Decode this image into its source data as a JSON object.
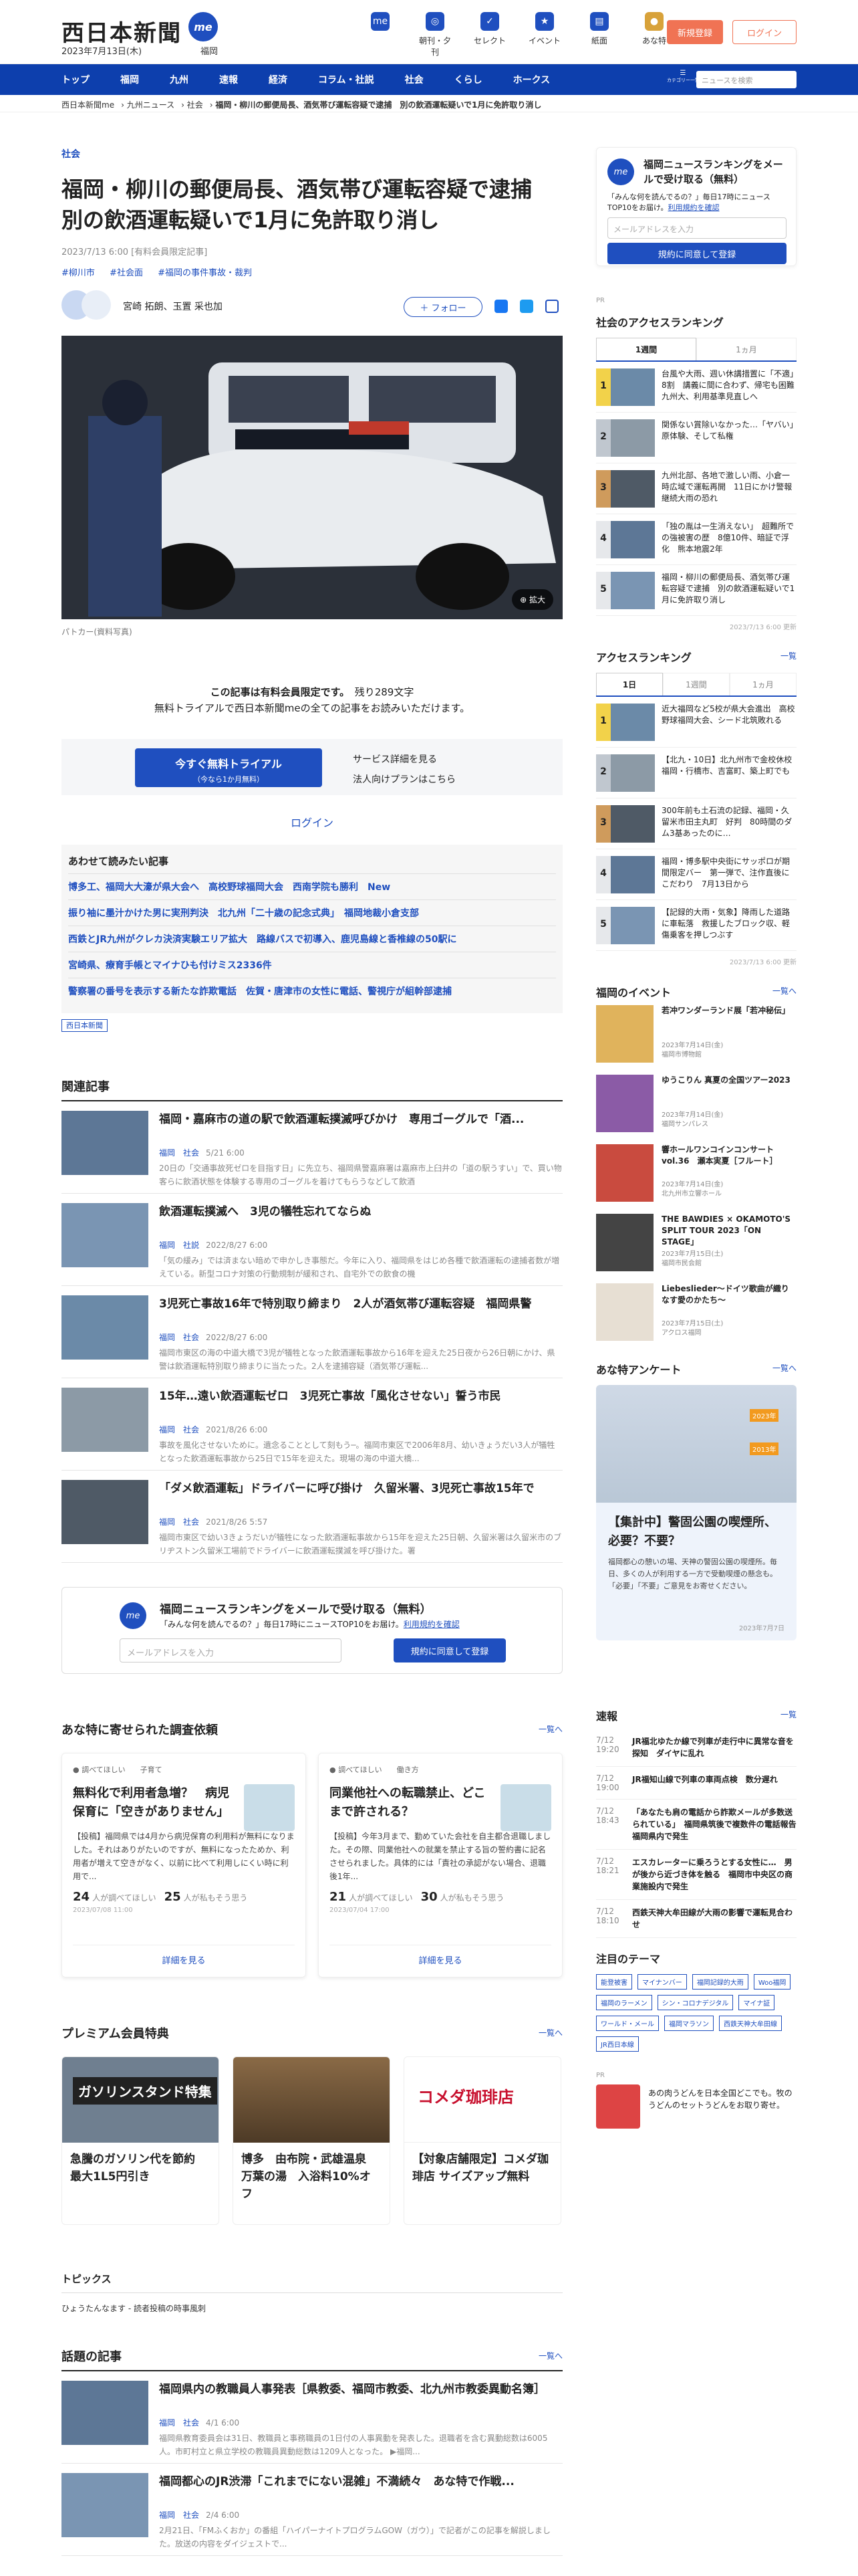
{
  "header": {
    "logo": "西日本新聞",
    "date": "2023年7月13日(木)",
    "me": "me",
    "region": "福岡",
    "icons": [
      "朝刊・夕刊",
      "セレクト",
      "イベント",
      "紙面",
      "あな特"
    ],
    "first_icon": "me",
    "register": "新規登録",
    "login": "ログイン"
  },
  "nav": {
    "items": [
      "トップ",
      "福岡",
      "九州",
      "速報",
      "経済",
      "コラム・社説",
      "社会",
      "くらし",
      "ホークス"
    ],
    "menu": "カテゴリー一覧",
    "search_placeholder": "ニュースを検索"
  },
  "breadcrumb": [
    "西日本新聞me",
    "九州ニュース",
    "社会",
    "福岡・柳川の郵便局長、酒気帯び運転容疑で逮捕　別の飲酒運転疑いで1月に免許取り消し"
  ],
  "article": {
    "category": "社会",
    "title": "福岡・柳川の郵便局長、酒気帯び運転容疑で逮捕　別の飲酒運転疑いで1月に免許取り消し",
    "meta": "2023/7/13 6:00 [有料会員限定記事]",
    "tags": [
      "#柳川市",
      "#社会面",
      "#福岡の事件事故・裁判"
    ],
    "authors": "宮崎 拓朗、玉置 采也加",
    "follow": "＋ フォロー",
    "zoom": "拡大",
    "caption": "パトカー(資料写真)"
  },
  "paywall": {
    "line1": "この記事は有料会員限定です。",
    "remaining": "残り289文字",
    "line2": "無料トライアルで西日本新聞meの全ての記事をお読みいただけます。",
    "trial": "今すぐ無料トライアル",
    "trial_sub": "（今なら1か月無料）",
    "svc": "サービス詳細を見る",
    "corp": "法人向けプランはこちら",
    "login": "ログイン"
  },
  "together": {
    "title": "あわせて読みたい記事",
    "items": [
      "博多工、福岡大大濠が県大会へ　高校野球福岡大会　西南学院も勝利　New",
      "振り袖に墨汁かけた男に実刑判決　北九州「二十歳の記念式典」　福岡地裁小倉支部",
      "西鉄とJR九州がクレカ決済実験エリア拡大　路線バスで初導入、鹿児島線と香椎線の50駅に",
      "宮崎県、療育手帳とマイナひも付けミス2336件",
      "警察署の番号を表示する新たな詐欺電話　佐賀・唐津市の女性に電話、警視庁が組幹部逮捕"
    ],
    "tag": "西日本新聞"
  },
  "related": {
    "title": "関連記事",
    "items": [
      {
        "t": "福岡・嘉麻市の道の駅で飲酒運転撲滅呼びかけ　専用ゴーグルで「酒...",
        "c": "福岡",
        "s": "社会",
        "dt": "5/21 6:00",
        "d": "20日の「交通事故死ゼロを目指す日」に先立ち、福岡県警嘉麻署は嘉麻市上臼井の「道の駅うすい」で、買い物客らに飲酒状態を体験する専用のゴーグルを着けてもらうなどして飲酒"
      },
      {
        "t": "飲酒運転撲滅へ　3児の犠牲忘れてならぬ",
        "c": "福岡",
        "s": "社説",
        "dt": "2022/8/27 6:00",
        "d": "「気の緩み」では済まない暗めで申かしき事態だ。今年に入り、福岡県をはじめ各種で飲酒運転の逮捕者数が増えている。新型コロナ対策の行動規制が緩和され、自宅外での飲食の機"
      },
      {
        "t": "3児死亡事故16年で特別取り締まり　2人が酒気帯び運転容疑　福岡県警",
        "c": "福岡",
        "s": "社会",
        "dt": "2022/8/27 6:00",
        "d": "福岡市東区の海の中道大橋で3児が犠牲となった飲酒運転事故から16年を迎えた25日夜から26日朝にかけ、県警は飲酒運転特別取り締まりに当たった。2人を逮捕容疑（酒気帯び運転..."
      },
      {
        "t": "15年…遠い飲酒運転ゼロ　3児死亡事故「風化させない」誓う市民",
        "c": "福岡",
        "s": "社会",
        "dt": "2021/8/26 6:00",
        "d": "事故を風化させないために。遺念ることとして刻もう─。福岡市東区で2006年8月、幼いきょうだい3人が犠牲となった飲酒運転事故から25日で15年を迎えた。現場の海の中道大橋..."
      },
      {
        "t": "「ダメ飲酒運転」ドライバーに呼び掛け　久留米署、3児死亡事故15年で",
        "c": "福岡",
        "s": "社会",
        "dt": "2021/8/26 5:57",
        "d": "福岡市東区で幼い3きょうだいが犠牲になった飲酒運転事故から15年を迎えた25日朝、久留米署は久留米市のブリヂストン久留米工場前でドライバーに飲酒運転撲滅を呼び掛けた。署"
      }
    ]
  },
  "newsletter": {
    "title": "福岡ニュースランキングをメールで受け取る（無料）",
    "sub": "「みんな何を読んでるの？」毎日17時にニュースTOP10をお届け。",
    "terms": "利用規約を確認",
    "placeholder": "メールアドレスを入力",
    "button": "規約に同意して登録"
  },
  "anatoku": {
    "title": "あな特に寄せられた調査依頼",
    "more": "一覧へ",
    "cards": [
      {
        "who": "調べてほしい",
        "tag": "子育て",
        "t": "無料化で利用者急増？　病児保育に「空きがありません」",
        "d": "【投稿】福岡県では4月から病児保育の利用料が無料になりました。それはありがたいのですが、無料になったためか、利用者が増えて空きがなく、以前に比べて利用しにくい時に利用で...",
        "n1": "24",
        "l1": "人が調べてほしい",
        "n2": "25",
        "l2": "人が私もそう思う",
        "dt": "2023/07/08 11:00",
        "more": "詳細を見る"
      },
      {
        "who": "調べてほしい",
        "tag": "働き方",
        "t": "同業他社への転職禁止、どこまで許される？",
        "d": "【投稿】今年3月まで、勤めていた会社を自主都合退職しました。その際、同業他社への就業を禁止する旨の誓約書に記名させられました。具体的には「責社の承認がない場合、退職後1年...",
        "n1": "21",
        "l1": "人が調べてほしい",
        "n2": "30",
        "l2": "人が私もそう思う",
        "dt": "2023/07/04 17:00",
        "more": "詳細を見る"
      }
    ]
  },
  "premium": {
    "title": "プレミアム会員特典",
    "more": "一覧へ",
    "cards": [
      {
        "label": "ガソリンスタンド特集",
        "t": "急騰のガソリン代を節約　最大1L5円引き"
      },
      {
        "label": "",
        "t": "博多　由布院・武雄温泉　万葉の湯　入浴料10%オフ"
      },
      {
        "label": "コメダ珈琲店",
        "t": "【対象店舗限定】コメダ珈琲店 サイズアップ無料"
      }
    ]
  },
  "topics": {
    "title": "トピックス",
    "items": [
      "ひょうたんなます - 読者投稿の時事風刺"
    ]
  },
  "talk": {
    "title": "話題の記事",
    "more": "一覧へ",
    "items": [
      {
        "t": "福岡県内の教職員人事発表［県教委、福岡市教委、北九州市教委異動名簿］",
        "c": "福岡",
        "s": "社会",
        "dt": "4/1 6:00",
        "d": "福岡県教育委員会は31日、教職員と事務職員の1日付の人事異動を発表した。退職者を含む異動総数は6005人。市町村立と県立学校の教職員異動総数は1209人となった。 ▶福岡..."
      },
      {
        "t": "福岡都心のJR渋滞「これまでにない混雑」不満続々　あな特で作戦...",
        "c": "福岡",
        "s": "社会",
        "dt": "2/4 6:00",
        "d": "2月21日、「FMふくおか」の番組「ハイパーナイトプログラムGOW（ガウ）」で記者がこの記事を解説しました。放送の内容をダイジェストで..."
      }
    ]
  },
  "side": {
    "nl": {
      "title": "福岡ニュースランキングをメールで受け取る（無料）",
      "sub": "「みんな何を読んでるの？」毎日17時にニュースTOP10をお届け。",
      "terms": "利用規約を確認",
      "placeholder": "メールアドレスを入力",
      "button": "規約に同意して登録"
    },
    "pr": "PR",
    "social_rank": {
      "title": "社会のアクセスランキング",
      "tabs": [
        "1週間",
        "1ヵ月"
      ],
      "items": [
        "台風や大雨、週い休講措置に「不適」8割　講義に間に合わず、帰宅も困難　九州大、利用基準見直しへ",
        "関係ない賞除いなかった…「ヤバい」原体験、そして私権",
        "九州北部、各地で激しい雨、小倉一時広域で運転再開　11日にかけ警報継続大雨の恐れ",
        "「独の胤は一生消えない」　超難所での強被害の歴　8億10件、暗証で浮化　熊本地震2年",
        "福岡・柳川の郵便局長、酒気帯び運転容疑で逮捕　別の飲酒運転疑いで1月に免許取り消し"
      ],
      "upd": "2023/7/13 6:00 更新"
    },
    "access_rank": {
      "title": "アクセスランキング",
      "more": "一覧",
      "tabs": [
        "1日",
        "1週間",
        "1ヵ月"
      ],
      "items": [
        "近大福岡など5校が県大会進出　高校野球福岡大会、シード北筑敗れる",
        "【北九・10日】北九州市で金校休校　福岡・行橋市、吉富町、築上町でも",
        "300年前も土石流の記録、福岡・久留米市田主丸町　好判　80時間のダム3基あったのに…",
        "福岡・博多駅中央街にサッポロが期間限定バー　第一弾で、注作直後にこだわり　7月13日から",
        "【記録的大雨・気象】降雨した道路に車転落　救援したブロック収、軽傷乗客を押しつぶす"
      ],
      "upd": "2023/7/13 6:00 更新"
    },
    "events": {
      "title": "福岡のイベント",
      "more": "一覧へ",
      "items": [
        {
          "t": "若冲ワンダーランド展「若冲秘伝」",
          "m": "2023年7月14日(金)\n福岡市博物館"
        },
        {
          "t": "ゆうこりん 真夏の全国ツアー2023",
          "m": "2023年7月14日(金)\n福岡サンパレス"
        },
        {
          "t": "響ホールワンコインコンサートvol.36　瀬本実夏［フルート］",
          "m": "2023年7月14日(金)\n北九州市立響ホール"
        },
        {
          "t": "THE BAWDIES × OKAMOTO'S SPLIT TOUR 2023「ON STAGE」",
          "m": "2023年7月15日(土)\n福岡市民会館"
        },
        {
          "t": "Liebeslieder〜ドイツ歌曲が織りなす愛のかたち〜",
          "m": "2023年7月15日(土)\nアクロス福岡"
        }
      ]
    },
    "enquete": {
      "title": "あな特アンケート",
      "more": "一覧へ",
      "badge1": "2023年",
      "badge2": "2013年",
      "t": "【集計中】警固公園の喫煙所、必要？不要？",
      "d": "福岡都心の憩いの場、天神の警固公園の喫煙所。毎日、多くの人が利用する一方で受動喫煙の懸念も。「必要」「不要」ご意見をお寄せください。",
      "dt": "2023年7月7日"
    },
    "flash": {
      "title": "速報",
      "more": "一覧",
      "items": [
        {
          "time": "7/12 19:20",
          "t": "JR福北ゆたか線で列車が走行中に異常な音を探知　ダイヤに乱れ"
        },
        {
          "time": "7/12 19:00",
          "t": "JR福知山線で列車の車両点検　数分遅れ"
        },
        {
          "time": "7/12 18:43",
          "t": "「あなたも肩の電話から詐欺メールが多数送られている」　福岡県筑後で複数件の電話報告　福岡県内で発生"
        },
        {
          "time": "7/12 18:21",
          "t": "エスカレーターに乗ろうとする女性に…　男が後から近づき体を触る　福岡市中央区の商業施設内で発生"
        },
        {
          "time": "7/12 18:10",
          "t": "西鉄天神大牟田線が大雨の影響で運転見合わせ"
        }
      ]
    },
    "themes": {
      "title": "注目のテーマ",
      "items": [
        "能登被害",
        "マイナンバー",
        "福岡記録的大雨",
        "Woo福岡",
        "福岡のラーメン",
        "シン・コロナデジタル",
        "マイナ証",
        "ワールド・メール",
        "福岡マラソン",
        "西鉄天神大牟田線",
        "JR西日本線"
      ]
    },
    "pr2": {
      "label": "PR",
      "t": "あの肉うどんを日本全国どこでも。牧のうどんのセットうどんをお取り寄せ。"
    }
  }
}
